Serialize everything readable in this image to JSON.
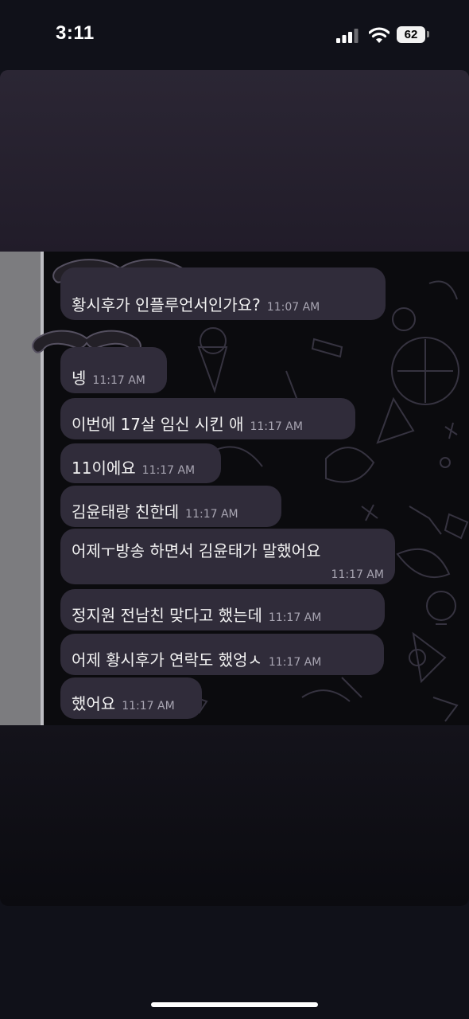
{
  "status_bar": {
    "time": "3:11",
    "battery": "62",
    "signal_icon": "cellular-signal-icon",
    "wifi_icon": "wifi-icon"
  },
  "chat": {
    "messages": [
      {
        "text": "황시후가 인플루언서인가요?",
        "time": "11:07 AM"
      },
      {
        "text": "넹",
        "time": "11:17 AM"
      },
      {
        "text": "이번에 17살 임신 시킨 애",
        "time": "11:17 AM"
      },
      {
        "text": "11이에요",
        "time": "11:17 AM"
      },
      {
        "text": "김윤태랑 친한데",
        "time": "11:17 AM"
      },
      {
        "text": "어제ㅜ방송 하면서 김윤태가 말했어요",
        "time": "11:17 AM"
      },
      {
        "text": "정지원 전남친 맞다고 했는데",
        "time": "11:17 AM"
      },
      {
        "text": "어제 황시후가 연락도 했엉ㅅ",
        "time": "11:17 AM"
      },
      {
        "text": "했어요",
        "time": "11:17 AM"
      }
    ]
  },
  "colors": {
    "bubble": "#302c3a",
    "chat_background": "#0b0b0e",
    "page_background": "#101119"
  }
}
